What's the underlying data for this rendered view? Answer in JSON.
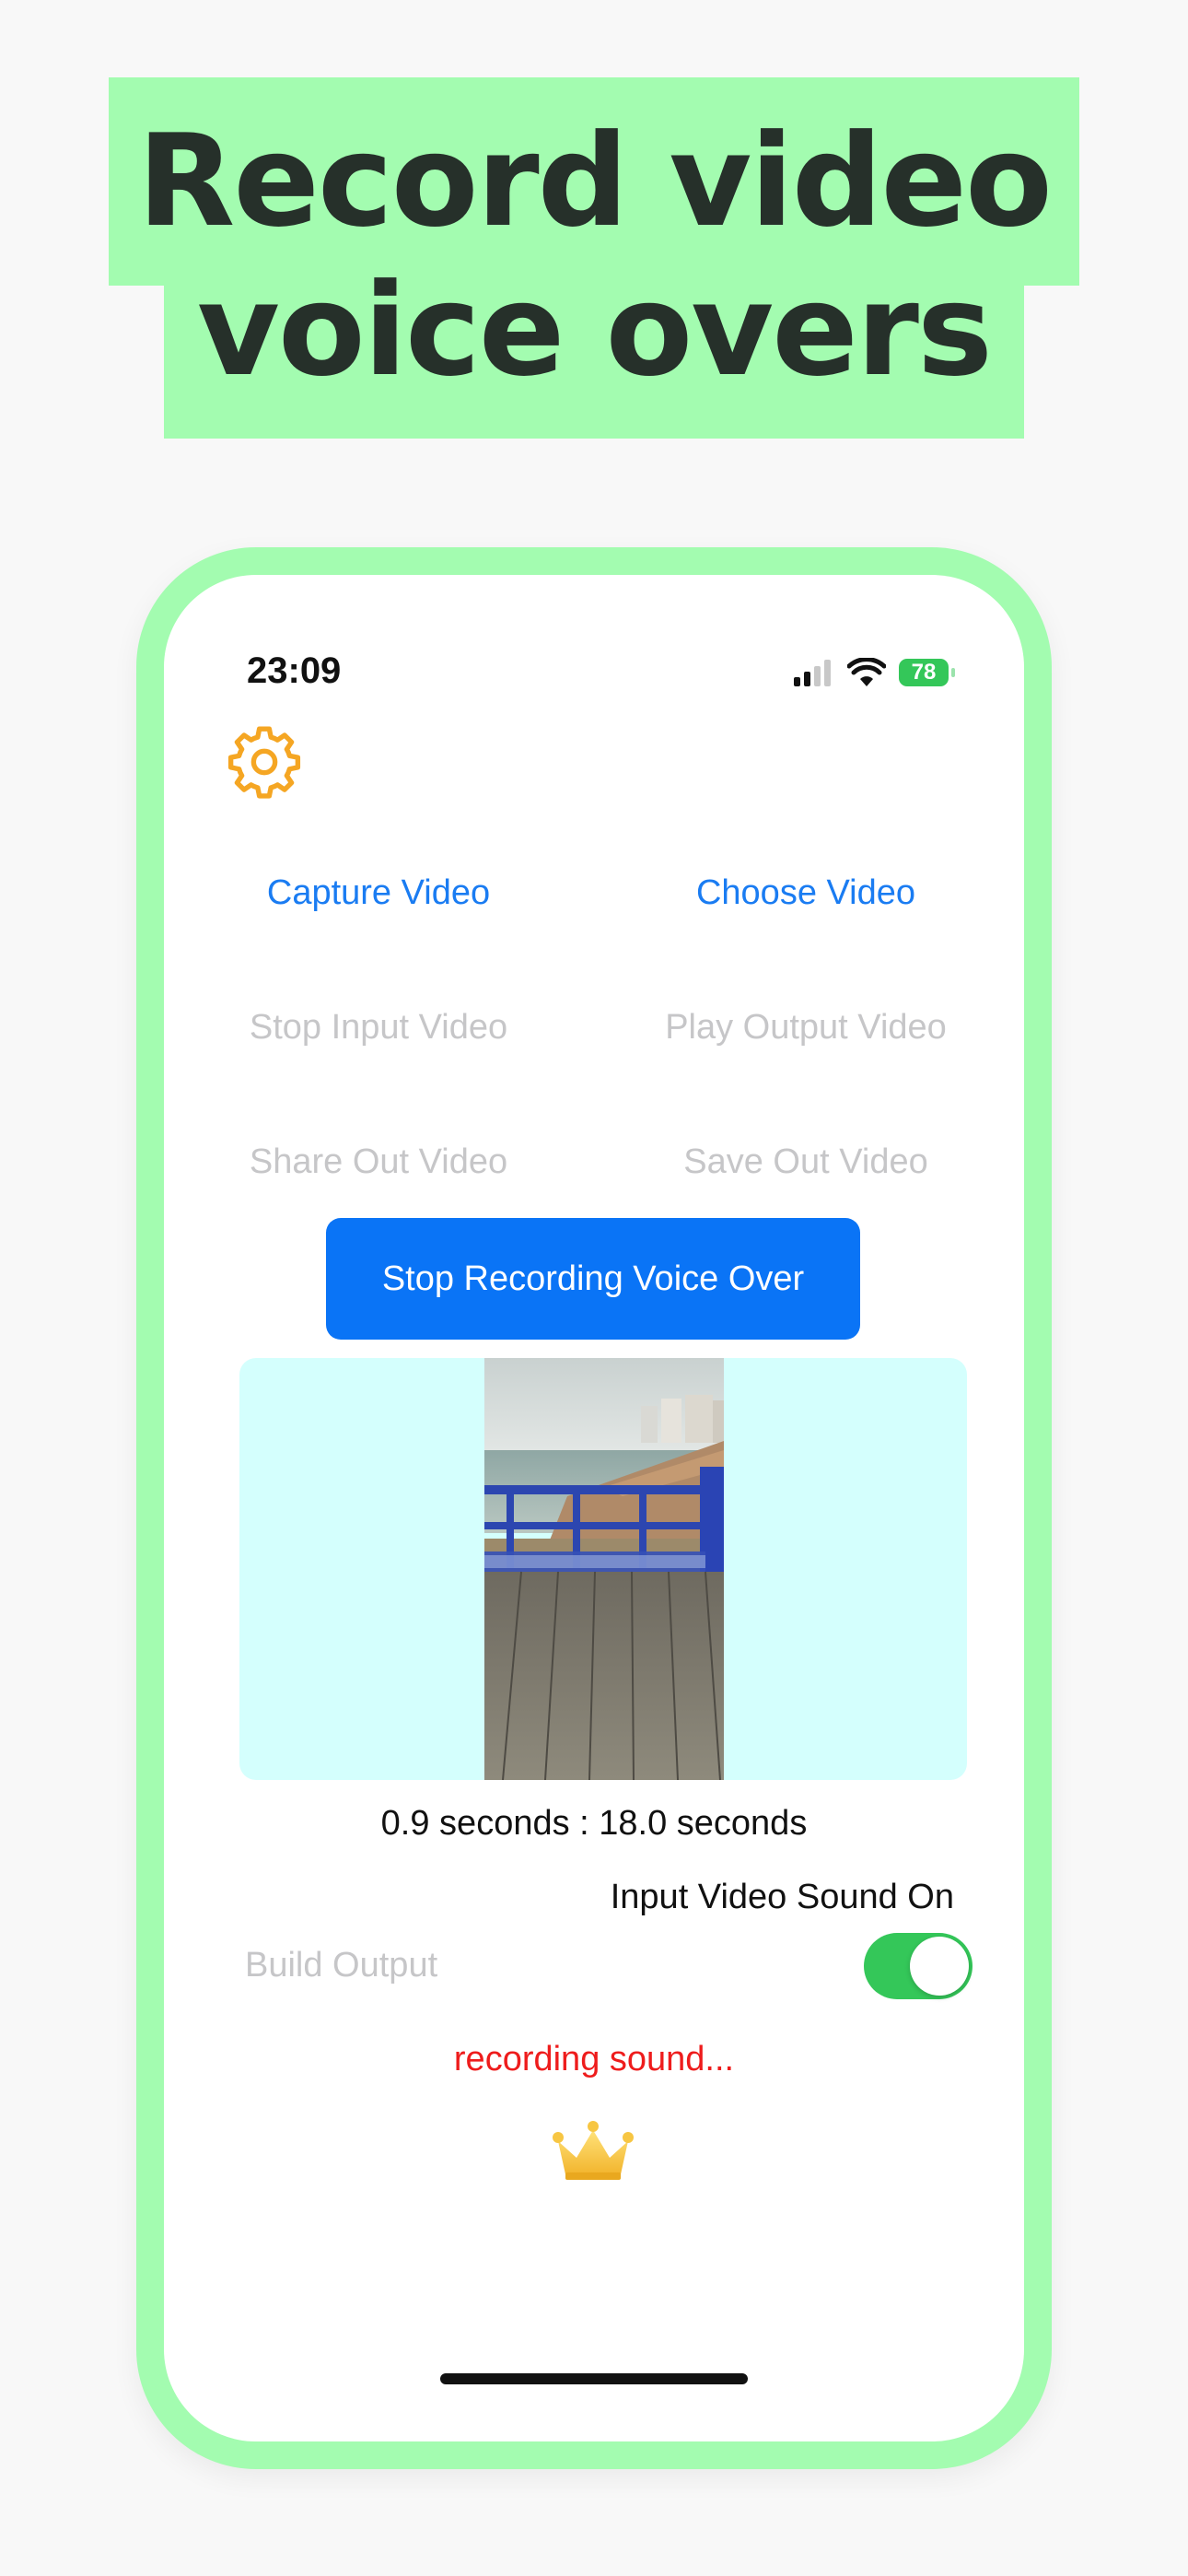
{
  "headline": {
    "line1": "Record video",
    "line2": "voice overs"
  },
  "status_bar": {
    "time": "23:09",
    "battery": "78"
  },
  "buttons": {
    "capture_video": "Capture Video",
    "choose_video": "Choose Video",
    "stop_input_video": "Stop Input Video",
    "play_output_video": "Play Output Video",
    "share_out_video": "Share Out Video",
    "save_out_video": "Save Out Video",
    "stop_recording": "Stop Recording Voice Over",
    "build_output": "Build Output"
  },
  "playback": {
    "duration_text": "0.9 seconds : 18.0 seconds"
  },
  "sound_toggle": {
    "label": "Input Video Sound On",
    "on": true
  },
  "status_text": "recording sound...",
  "colors": {
    "accent_green": "#a3fcb0",
    "primary_blue": "#0a74f6",
    "link_blue": "#1a7cf2",
    "disabled_grey": "#c6c6c8",
    "recording_red": "#ee1c1c",
    "video_panel_bg": "#d4fffd",
    "toggle_on": "#34c759",
    "gear_orange": "#f5a623"
  },
  "icons": [
    "gear-icon",
    "cellular-signal-icon",
    "wifi-icon",
    "battery-icon",
    "crown-icon"
  ]
}
